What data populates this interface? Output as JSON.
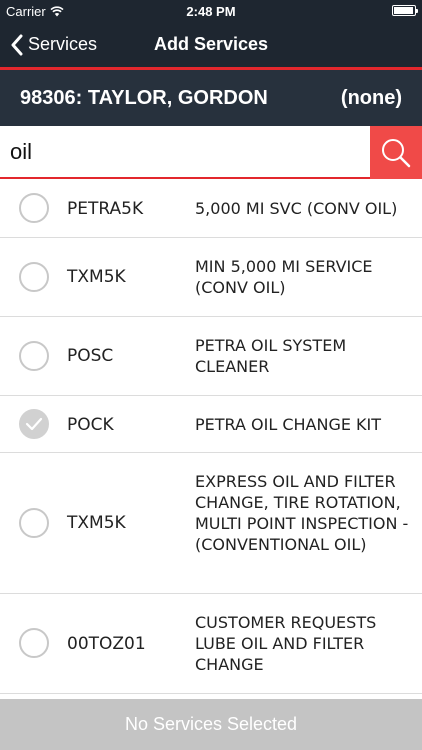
{
  "status_bar": {
    "carrier": "Carrier",
    "time": "2:48 PM"
  },
  "nav": {
    "back_label": "Services",
    "title": "Add Services"
  },
  "customer": {
    "name": "98306: TAYLOR, GORDON",
    "ro": "(none)"
  },
  "search": {
    "value": "oil"
  },
  "services": [
    {
      "code": "PETRA5K",
      "description": "5,000 MI SVC (CONV OIL)",
      "selected": false
    },
    {
      "code": "TXM5K",
      "description": "MIN 5,000 MI SERVICE (CONV OIL)",
      "selected": false
    },
    {
      "code": "POSC",
      "description": "PETRA OIL SYSTEM CLEANER",
      "selected": false
    },
    {
      "code": "POCK",
      "description": "PETRA OIL CHANGE KIT",
      "selected": true
    },
    {
      "code": "TXM5K",
      "description": "EXPRESS OIL AND FILTER CHANGE, TIRE ROTATION, MULTI POINT INSPECTION - (CONVENTIONAL OIL)",
      "selected": false
    },
    {
      "code": "00TOZ01",
      "description": "CUSTOMER REQUESTS LUBE OIL AND FILTER CHANGE",
      "selected": false
    }
  ],
  "footer": {
    "label": "No Services Selected"
  },
  "colors": {
    "nav_bg": "#1e2630",
    "accent_red": "#e3272d",
    "search_button": "#f04a48",
    "footer_bg": "#c4c4c4"
  },
  "icons": {
    "back": "chevron-left-icon",
    "search": "search-icon",
    "wifi": "wifi-icon",
    "battery": "battery-icon",
    "check": "checkmark-icon"
  }
}
